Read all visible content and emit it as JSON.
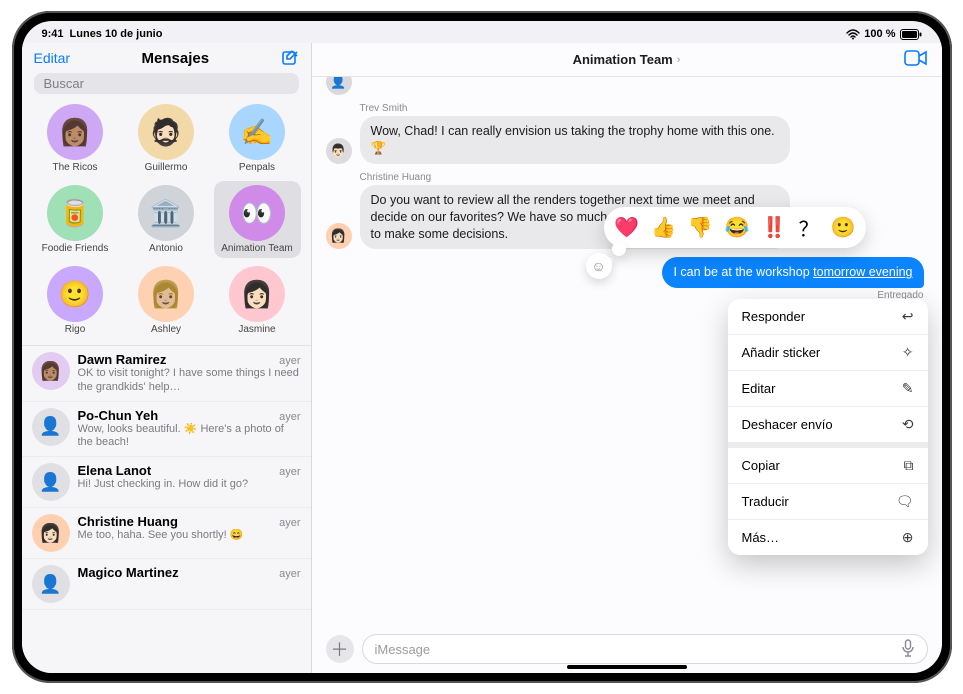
{
  "status": {
    "time": "9:41",
    "date": "Lunes 10 de junio",
    "battery": "100 %"
  },
  "sidebar": {
    "edit": "Editar",
    "title": "Mensajes",
    "search_placeholder": "Buscar",
    "pins": [
      {
        "name": "The Ricos",
        "av_bg": "#cfa8f5",
        "av_emoji": "👩🏽"
      },
      {
        "name": "Guillermo",
        "av_bg": "#f3d9a8",
        "av_emoji": "🧔🏻"
      },
      {
        "name": "Penpals",
        "av_bg": "#a9d6ff",
        "av_emoji": "✍️"
      },
      {
        "name": "Foodie Friends",
        "av_bg": "#9fe0b6",
        "av_emoji": "🥫"
      },
      {
        "name": "Antonio",
        "av_bg": "#d0d4d8",
        "av_emoji": "🏛️"
      },
      {
        "name": "Animation Team",
        "av_bg": "#d08be8",
        "av_emoji": "👀",
        "selected": true
      },
      {
        "name": "Rigo",
        "av_bg": "#c9a8ff",
        "av_emoji": "🙂"
      },
      {
        "name": "Ashley",
        "av_bg": "#ffd1b3",
        "av_emoji": "👩🏼"
      },
      {
        "name": "Jasmine",
        "av_bg": "#ffc7cf",
        "av_emoji": "👩🏻"
      }
    ],
    "conversations": [
      {
        "name": "Dawn Ramirez",
        "time": "ayer",
        "preview": "OK to visit tonight? I have some things I need the grandkids' help…",
        "av_bg": "#e2ccf2",
        "av_emoji": "👩🏽"
      },
      {
        "name": "Po-Chun Yeh",
        "time": "ayer",
        "preview": "Wow, looks beautiful. ☀️ Here's a photo of the beach!",
        "av_bg": "#e0e0e4",
        "av_emoji": "👤"
      },
      {
        "name": "Elena Lanot",
        "time": "ayer",
        "preview": "Hi! Just checking in. How did it go?",
        "av_bg": "#e0e0e4",
        "av_emoji": "👤"
      },
      {
        "name": "Christine Huang",
        "time": "ayer",
        "preview": "Me too, haha. See you shortly! 😄",
        "av_bg": "#ffd0b0",
        "av_emoji": "👩🏻"
      },
      {
        "name": "Magico Martinez",
        "time": "ayer",
        "preview": "",
        "av_bg": "#e0e0e4",
        "av_emoji": "👤"
      }
    ]
  },
  "chat": {
    "title": "Animation Team",
    "messages": {
      "m1_sender": "Trev Smith",
      "m1_text": "Wow, Chad! I can really envision us taking the trophy home with this one. 🏆",
      "m2_sender": "Christine Huang",
      "m2_text": "Do you want to review all the renders together next time we meet and decide on our favorites? We have so much amazing work now, just need to make some decisions.",
      "mine_pre": "I can be at the workshop ",
      "mine_link": "tomorrow evening",
      "delivered": "Entregado"
    },
    "reactions": [
      "❤️",
      "👍",
      "👎",
      "😂",
      "‼️",
      "？",
      "🙂"
    ],
    "context_menu": [
      {
        "label": "Responder",
        "icon": "↩"
      },
      {
        "label": "Añadir sticker",
        "icon": "✧"
      },
      {
        "label": "Editar",
        "icon": "✎"
      },
      {
        "label": "Deshacer envío",
        "icon": "⟲"
      },
      {
        "label": "Copiar",
        "icon": "⧉",
        "gap": true
      },
      {
        "label": "Traducir",
        "icon": "🗨"
      },
      {
        "label": "Más…",
        "icon": "⊕"
      }
    ],
    "composer_placeholder": "iMessage"
  }
}
